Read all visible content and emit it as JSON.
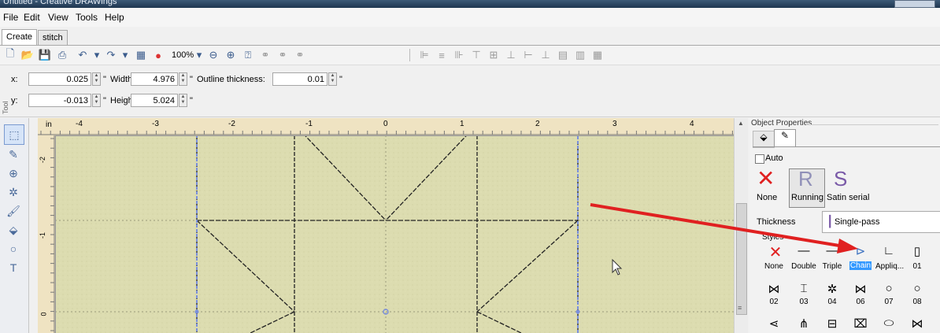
{
  "window": {
    "title": "Untitled - Creative DRAWings"
  },
  "menu": [
    "File",
    "Edit",
    "View",
    "Tools",
    "Help"
  ],
  "tabs": [
    "Create",
    "stitch"
  ],
  "toolbar": {
    "zoom": "100%"
  },
  "props": {
    "x_label": "x:",
    "x_value": "0.025",
    "x_unit": "\"",
    "width_label": "Width:",
    "width_value": "4.976",
    "width_unit": "\"",
    "outline_label": "Outline thickness:",
    "outline_value": "0.01",
    "outline_unit": "\"",
    "y_label": "y:",
    "y_value": "-0.013",
    "y_unit": "\"",
    "height_label": "Height:",
    "height_value": "5.024",
    "height_unit": "\"",
    "side_label": "Tool"
  },
  "ruler": {
    "unit": "in",
    "top_ticks": [
      "-4",
      "-3",
      "-2",
      "-1",
      "0",
      "1",
      "2",
      "3",
      "4"
    ],
    "left_ticks": [
      "-2",
      "-1",
      "0"
    ]
  },
  "panel": {
    "title": "Object Properties",
    "auto_label": "Auto",
    "stitch_types": [
      "None",
      "Running",
      "Satin serial"
    ],
    "thickness_label": "Thickness",
    "thickness_value": "Single-pass",
    "styles_label": "Styles",
    "styles_row1": [
      "None",
      "Double",
      "Triple",
      "Chain",
      "Appliq...",
      "01"
    ],
    "styles_row2": [
      "02",
      "03",
      "04",
      "06",
      "07",
      "08"
    ]
  },
  "colors": {
    "canvas": "#dcdcb0",
    "selection": "#7a8fdc",
    "arrow": "#e02020",
    "highlight": "#3399ff"
  }
}
